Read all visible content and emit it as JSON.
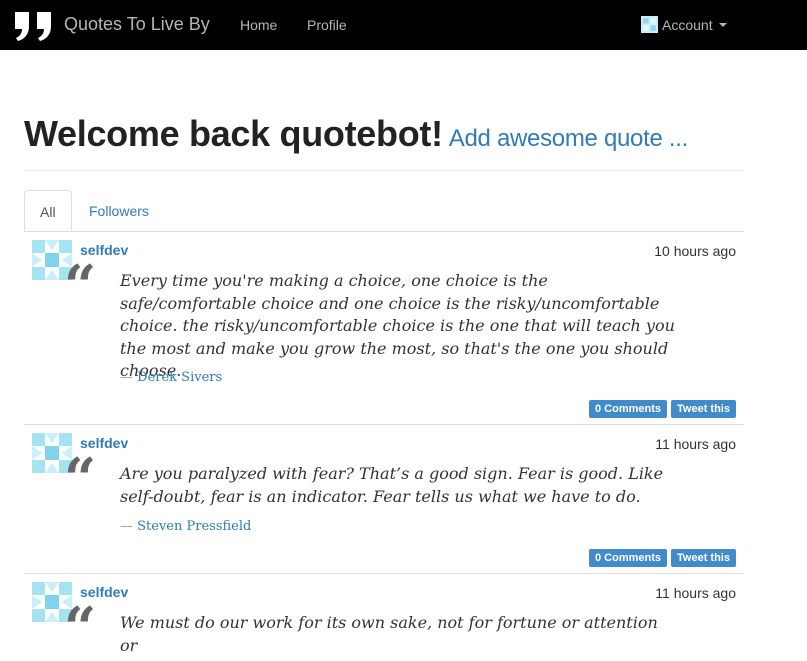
{
  "navbar": {
    "brand": "Quotes To Live By",
    "links": [
      "Home",
      "Profile"
    ],
    "account_label": "Account"
  },
  "header": {
    "title": "Welcome back quotebot!",
    "add_link": "Add awesome quote ..."
  },
  "tabs": [
    "All",
    "Followers"
  ],
  "quotes": [
    {
      "user": "selfdev",
      "time": "10 hours ago",
      "text": "Every time you're making a choice, one choice is the safe/comfortable choice and one choice is the risky/uncomfortable choice. the risky/uncomfortable choice is the one that will teach you the most and make you grow the most, so that's the one you should choose.",
      "author": "Derek Sivers",
      "comments": "0 Comments",
      "tweet": "Tweet this"
    },
    {
      "user": "selfdev",
      "time": "11 hours ago",
      "text": "Are you paralyzed with fear? That’s a good sign. Fear is good. Like self-doubt, fear is an indicator. Fear tells us what we have to do.",
      "author": "Steven Pressfield",
      "comments": "0 Comments",
      "tweet": "Tweet this"
    },
    {
      "user": "selfdev",
      "time": "11 hours ago",
      "text": "We must do our work for its own sake, not for fortune or attention or"
    }
  ],
  "colors": {
    "link": "#337ab7",
    "button": "#428bca",
    "navbar": "#000000"
  }
}
